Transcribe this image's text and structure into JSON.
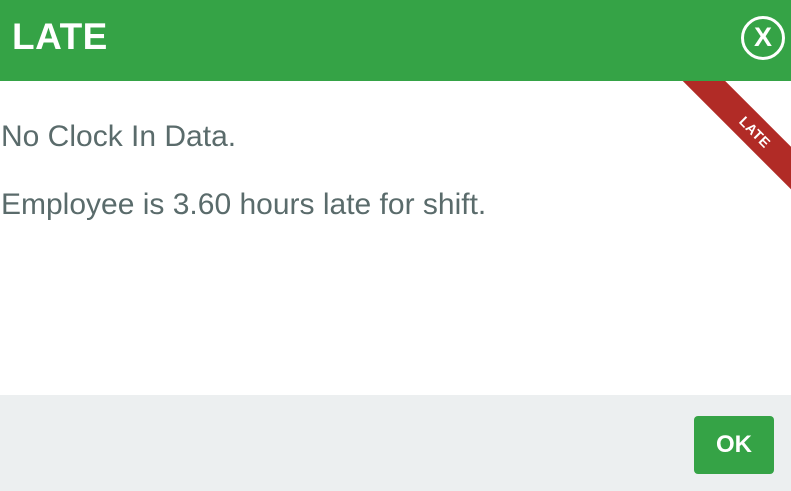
{
  "dialog": {
    "title": "LATE",
    "close_label": "X"
  },
  "ribbon": {
    "label": "LATE"
  },
  "messages": [
    "No Clock In Data.",
    "Employee is 3.60 hours late for shift."
  ],
  "footer": {
    "ok_label": "OK"
  },
  "colors": {
    "header": "#35a346",
    "ribbon": "#b12b26",
    "text": "#5a6b6b",
    "footer": "#eceff0"
  }
}
